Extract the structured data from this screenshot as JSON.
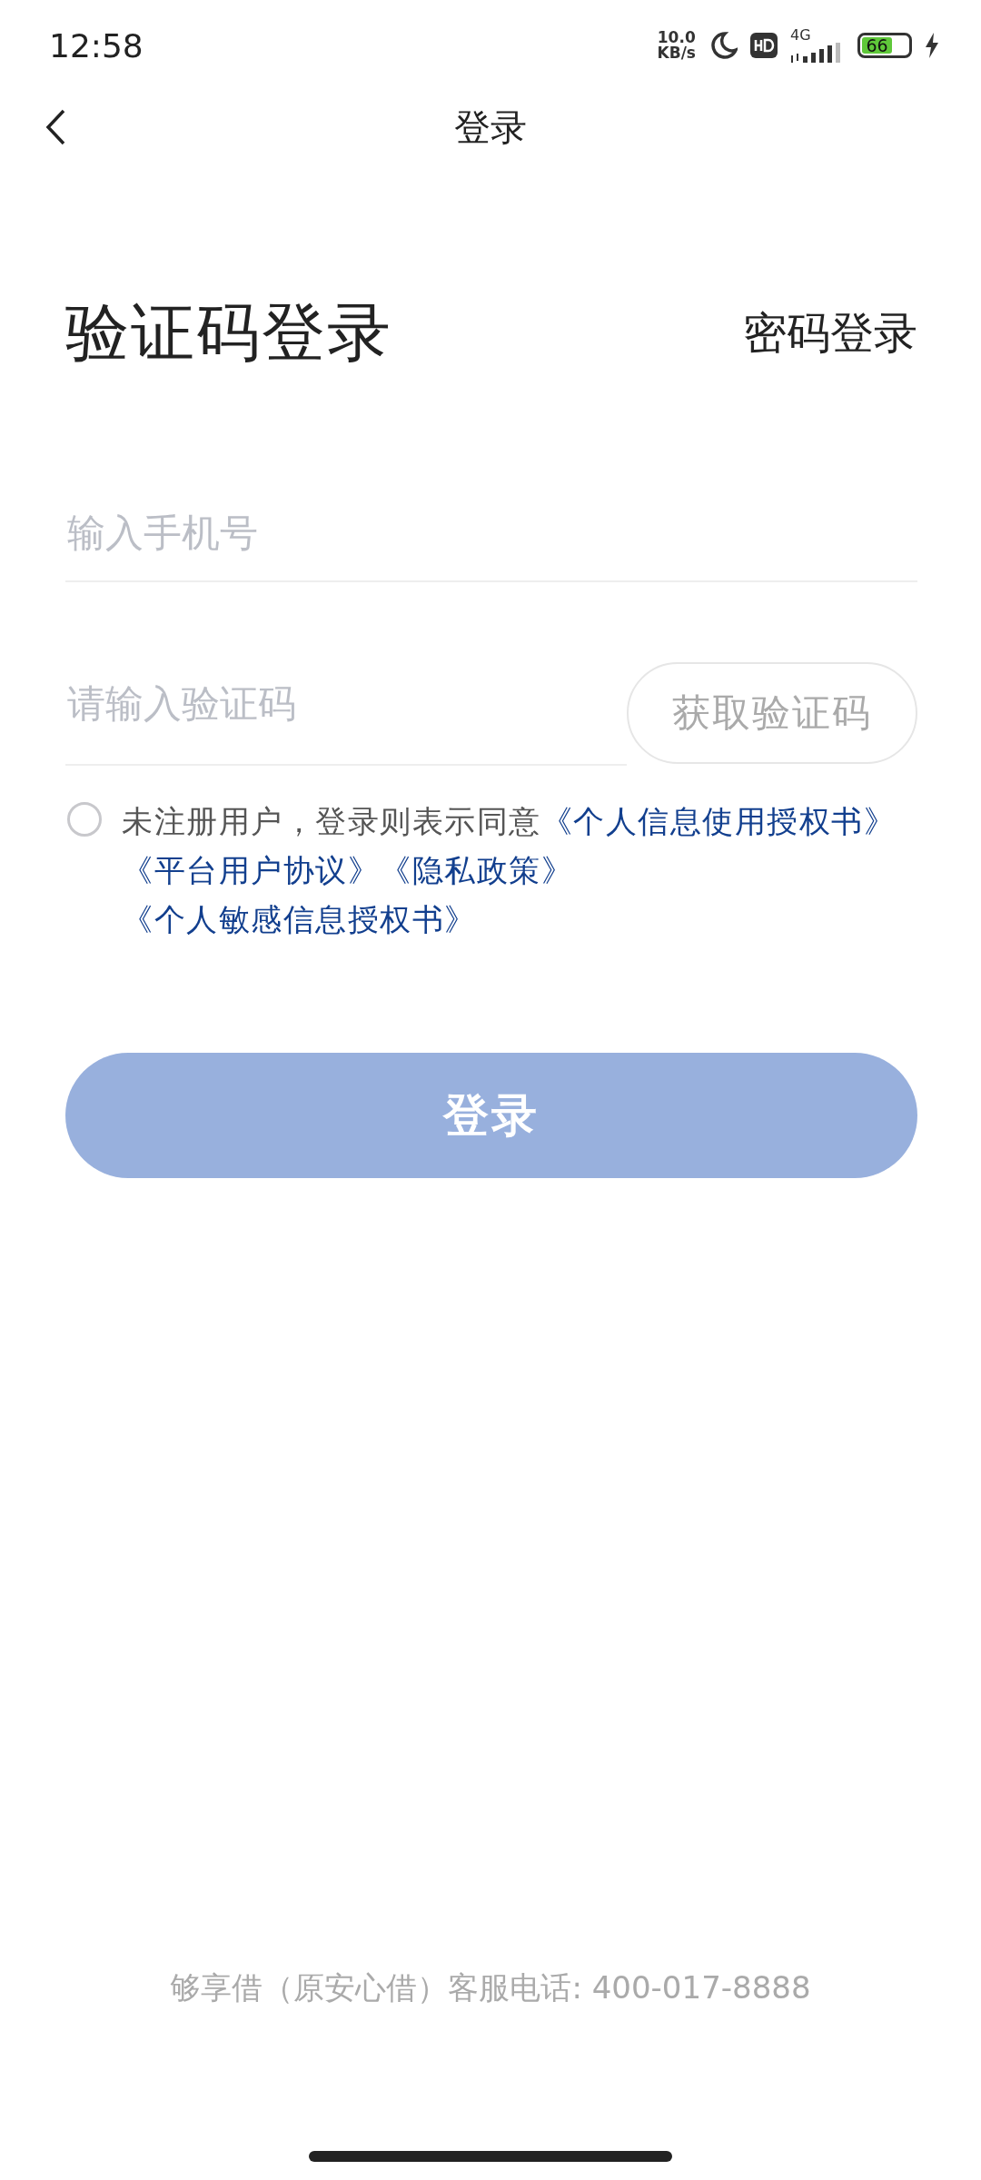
{
  "status_bar": {
    "time": "12:58",
    "speed_value": "10.0",
    "speed_unit": "KB/s",
    "network": "4G",
    "battery": "66"
  },
  "nav": {
    "title": "登录"
  },
  "heading": {
    "title": "验证码登录",
    "switch_link": "密码登录"
  },
  "phone_field": {
    "placeholder": "输入手机号"
  },
  "code_field": {
    "placeholder": "请输入验证码"
  },
  "code_button": {
    "label": "获取验证码",
    "disabled": true
  },
  "agreement": {
    "checked": false,
    "text": "未注册用户，登录则表示同意",
    "links": [
      "《个人信息使用授权书》",
      "《平台用户协议》",
      "《隐私政策》",
      "《个人敏感信息授权书》"
    ]
  },
  "login_button": {
    "label": "登录",
    "disabled": true
  },
  "footer": {
    "text": "够享借（原安心借）客服电话: 400-017-8888"
  }
}
